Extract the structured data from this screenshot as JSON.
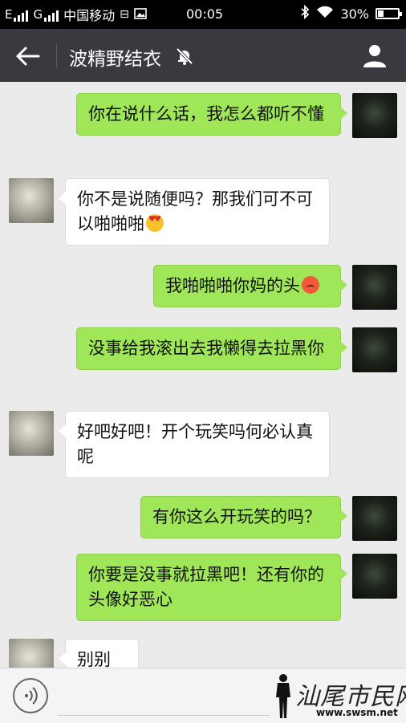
{
  "status_bar": {
    "carrier": "中国移动",
    "time": "00:05",
    "battery": "30%",
    "battery_level": 0.3,
    "left_icons": [
      "signal-e-icon",
      "signal-g-icon",
      "hd-icon",
      "image-icon"
    ],
    "right_icons": [
      "bluetooth-icon",
      "wifi-icon",
      "battery-icon"
    ]
  },
  "header": {
    "title": "波精野结衣",
    "back_icon": "arrow-left-icon",
    "mute_icon": "bell-off-icon",
    "profile_icon": "person-icon"
  },
  "messages": [
    {
      "from": "me",
      "text": "你在说什么话，我怎么都听不懂"
    },
    {
      "from": "them",
      "text": "你不是说随便吗？那我们可不可以啪啪啪",
      "emoji": "heart-eyes-emoji"
    },
    {
      "from": "me",
      "text": "我啪啪啪你妈的头",
      "emoji": "angry-face-emoji"
    },
    {
      "from": "me",
      "text": "没事给我滚出去我懒得去拉黑你"
    },
    {
      "from": "them",
      "text": "好吧好吧！开个玩笑吗何必认真呢"
    },
    {
      "from": "me",
      "text": "有你这么开玩笑的吗？"
    },
    {
      "from": "me",
      "text": "你要是没事就拉黑吧！还有你的头像好恶心"
    },
    {
      "from": "them",
      "text": "别别别"
    }
  ],
  "input_bar": {
    "voice_icon": "voice-wave-icon",
    "placeholder": ""
  },
  "watermark": {
    "text": "汕尾市民网",
    "url": "www.swsm.net"
  },
  "colors": {
    "title_bar": "#393a3f",
    "my_bubble": "#9fe658",
    "their_bubble": "#ffffff",
    "chat_bg": "#ebebeb"
  }
}
